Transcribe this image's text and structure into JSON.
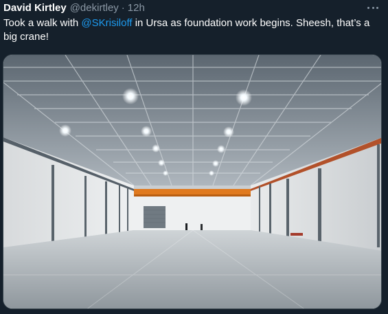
{
  "tweet": {
    "author_name": "David Kirtley",
    "author_handle": "@dekirtley",
    "separator": "·",
    "timestamp": "12h",
    "text_before": "Took a walk with ",
    "mention": "@SKrisiloff",
    "text_after": " in Ursa as foundation work begins. Sheesh, that’s a big crane!",
    "more_icon": "more-horizontal-icon",
    "media": {
      "description_icon": "warehouse-photo"
    }
  },
  "colors": {
    "background": "#15202b",
    "text": "#ffffff",
    "secondary_text": "#8b98a5",
    "link": "#1d9bf0",
    "crane": "#e07a1f"
  }
}
